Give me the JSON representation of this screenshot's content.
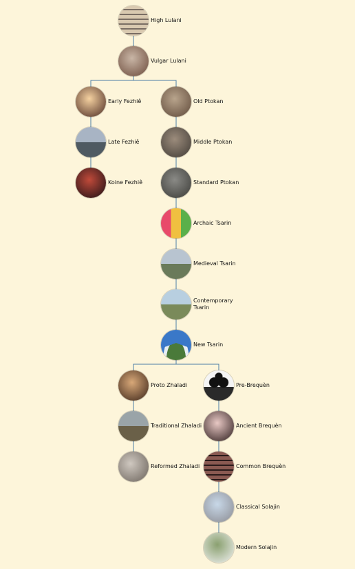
{
  "nodes": [
    {
      "id": "high-lulani",
      "label": "High Lulani",
      "parent": null,
      "image": "stacked-stones",
      "colors": [
        "#d9c9b0",
        "#7a6e64"
      ]
    },
    {
      "id": "vulgar-lulani",
      "label": "Vulgar  Lulani",
      "parent": "high-lulani",
      "image": "shell",
      "colors": [
        "#c9b6a6",
        "#6b4a3a"
      ]
    },
    {
      "id": "early-fezhie",
      "label": "Early  Fezhiê",
      "parent": "vulgar-lulani",
      "image": "candle-light",
      "colors": [
        "#f5d1a0",
        "#4a2a22"
      ]
    },
    {
      "id": "late-fezhie",
      "label": "Late Fezhiê",
      "parent": "early-fezhie",
      "image": "mountain-lake",
      "colors": [
        "#a8b4c4",
        "#4f5a62"
      ]
    },
    {
      "id": "koine-fezhie",
      "label": "Koine Fezhiê",
      "parent": "late-fezhie",
      "image": "night-street",
      "colors": [
        "#c04a3a",
        "#1a0f14"
      ]
    },
    {
      "id": "old-ptokan",
      "label": "Old Ptokan",
      "parent": "vulgar-lulani",
      "image": "shelves",
      "colors": [
        "#b8a48c",
        "#5e4838"
      ]
    },
    {
      "id": "middle-ptokan",
      "label": "Middle  Ptokan",
      "parent": "old-ptokan",
      "image": "forest-water",
      "colors": [
        "#9c8c7c",
        "#3f3a34"
      ]
    },
    {
      "id": "standard-ptokan",
      "label": "Standard Ptokan",
      "parent": "middle-ptokan",
      "image": "tree-branches",
      "colors": [
        "#8a8a86",
        "#3a3a36"
      ]
    },
    {
      "id": "archaic-tsarin",
      "label": "Archaic Tsarin",
      "parent": "standard-ptokan",
      "image": "color-grid",
      "colors": [
        "#e84a6a",
        "#5ab04a"
      ]
    },
    {
      "id": "medieval-tsarin",
      "label": "Medieval  Tsarin",
      "parent": "archaic-tsarin",
      "image": "road-field",
      "colors": [
        "#b8c4d0",
        "#6a7a5a"
      ]
    },
    {
      "id": "contemporary-tsarin",
      "label": "Contemporary Tsarin",
      "parent": "medieval-tsarin",
      "image": "meadow-trees",
      "colors": [
        "#b8cfe0",
        "#7a8a5a"
      ]
    },
    {
      "id": "new-tsarin",
      "label": "New Tsarin",
      "parent": "contemporary-tsarin",
      "image": "volcano",
      "colors": [
        "#3a78c8",
        "#4a7a3a"
      ]
    },
    {
      "id": "proto-zhaladi",
      "label": "Proto Zhaladi",
      "parent": "new-tsarin",
      "image": "portrait",
      "colors": [
        "#d8a878",
        "#3a2418"
      ]
    },
    {
      "id": "traditional-zhaladi",
      "label": "Traditional Zhaladi",
      "parent": "proto-zhaladi",
      "image": "aerial-field",
      "colors": [
        "#9aa4a8",
        "#6a6048"
      ]
    },
    {
      "id": "reformed-zhaladi",
      "label": "Reformed Zhaladi",
      "parent": "traditional-zhaladi",
      "image": "moon",
      "colors": [
        "#cfc8c0",
        "#6a625a"
      ]
    },
    {
      "id": "pre-brequen",
      "label": "Pre-Brequèn",
      "parent": "new-tsarin",
      "image": "panda",
      "colors": [
        "#f4f4f4",
        "#111111"
      ]
    },
    {
      "id": "ancient-brequen",
      "label": "Ancient Brequèn",
      "parent": "pre-brequen",
      "image": "pink-plate",
      "colors": [
        "#e8c8c4",
        "#2a1a1a"
      ]
    },
    {
      "id": "common-brequen",
      "label": "Common Brequèn",
      "parent": "ancient-brequen",
      "image": "stacked-coins",
      "colors": [
        "#8a5a52",
        "#2a1a1a"
      ]
    },
    {
      "id": "classical-solajin",
      "label": "Classical Solajin",
      "parent": "common-brequen",
      "image": "tower-block",
      "colors": [
        "#c8d8e8",
        "#8a8a90"
      ]
    },
    {
      "id": "modern-solajin",
      "label": "Modern Solajin",
      "parent": "classical-solajin",
      "image": "white-bird",
      "colors": [
        "#8aa070",
        "#f2f2f2"
      ]
    }
  ],
  "colors": {
    "background": "#fdf5da",
    "connector": "#4a7da6",
    "text": "#111111"
  }
}
